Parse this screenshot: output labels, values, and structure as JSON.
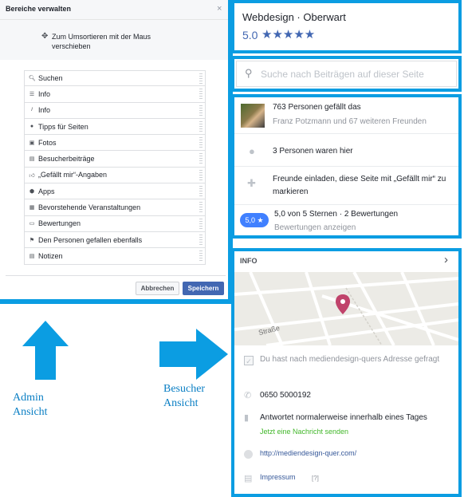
{
  "admin": {
    "title": "Bereiche verwalten",
    "close": "×",
    "hint_icon": "✥",
    "hint": "Zum Umsortieren mit der Maus verschieben",
    "items": [
      {
        "label": "Suchen",
        "icon": "search-icon",
        "glyph": "🔍︎"
      },
      {
        "label": "Info",
        "icon": "list-icon",
        "glyph": "☰"
      },
      {
        "label": "Info",
        "icon": "info-icon",
        "glyph": "𝑖"
      },
      {
        "label": "Tipps für Seiten",
        "icon": "tip-icon",
        "glyph": "●"
      },
      {
        "label": "Fotos",
        "icon": "photo-icon",
        "glyph": "▣"
      },
      {
        "label": "Besucherbeiträge",
        "icon": "post-icon",
        "glyph": "▤"
      },
      {
        "label": "„Gefällt mir“-Angaben",
        "icon": "like-icon",
        "glyph": "👍︎"
      },
      {
        "label": "Apps",
        "icon": "apps-icon",
        "glyph": "⬢"
      },
      {
        "label": "Bevorstehende Veranstaltungen",
        "icon": "calendar-icon",
        "glyph": "▦"
      },
      {
        "label": "Bewertungen",
        "icon": "review-icon",
        "glyph": "▭"
      },
      {
        "label": "Den Personen gefallen ebenfalls",
        "icon": "flag-icon",
        "glyph": "⚑"
      },
      {
        "label": "Notizen",
        "icon": "notes-icon",
        "glyph": "▤"
      }
    ],
    "cancel": "Abbrechen",
    "save": "Speichern"
  },
  "captions": {
    "admin": "Admin Ansicht",
    "visitor": "Besucher Ansicht"
  },
  "visitor": {
    "page_name": "Webdesign · Oberwart",
    "rating": "5.0",
    "stars": "★★★★★",
    "search_placeholder": "Suche nach Beiträgen auf dieser Seite",
    "likes": "763 Personen gefällt das",
    "friends": "Franz Potzmann und 67 weiteren Freunden",
    "visits": "3 Personen waren hier",
    "invite": "Freunde einladen, diese Seite mit „Gefällt mir“ zu markieren",
    "rating_badge": "5,0 ★",
    "rating_text": "5,0 von 5 Sternen · 2 Bewertungen",
    "reviews_link": "Bewertungen anzeigen",
    "info": {
      "label": "INFO",
      "chevron": "›",
      "street": "Straße",
      "asked": "Du hast nach mediendesign-quers Adresse gefragt",
      "check": "✓",
      "phone": "0650 5000192",
      "responds": "Antwortet normalerweise innerhalb eines Tages",
      "send": "Jetzt eine Nachricht senden",
      "website": "http://mediendesign-quer.com/",
      "impressum": "Impressum",
      "qmark": "[?]"
    }
  },
  "colors": {
    "frame": "#0b9de2",
    "brand": "#4267b2",
    "green": "#42b72a",
    "pin": "#c0436b"
  }
}
